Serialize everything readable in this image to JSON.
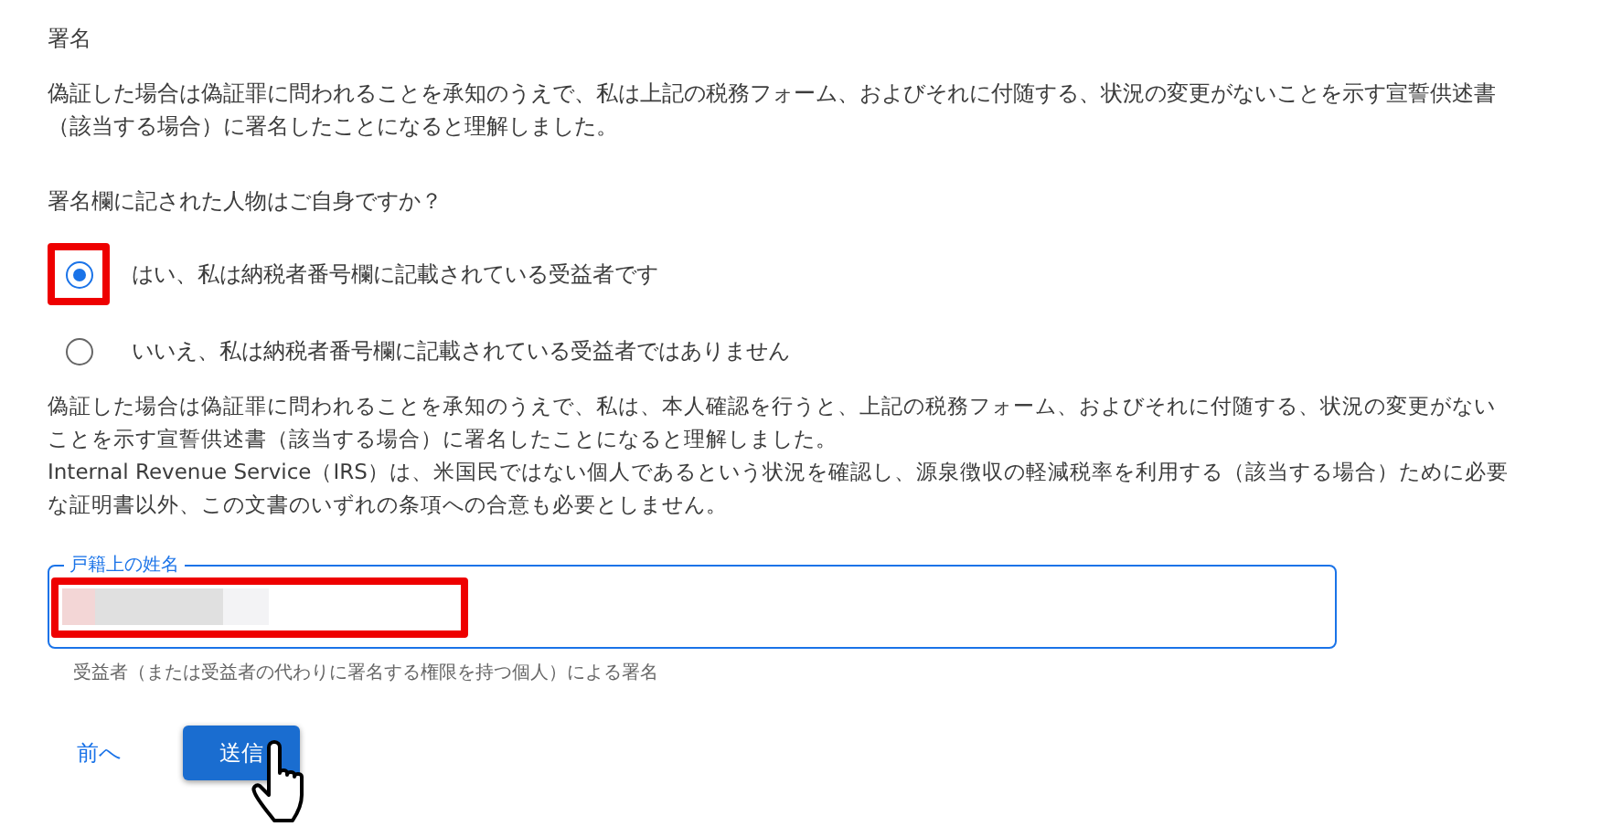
{
  "section_title": "署名",
  "statement": "偽証した場合は偽証罪に問われることを承知のうえで、私は上記の税務フォーム、およびそれに付随する、状況の変更がないことを示す宣誓供述書（該当する場合）に署名したことになると理解しました。",
  "question": "署名欄に記された人物はご自身ですか？",
  "options": [
    {
      "label": "はい、私は納税者番号欄に記載されている受益者です",
      "selected": true,
      "highlighted": true
    },
    {
      "label": "いいえ、私は納税者番号欄に記載されている受益者ではありません",
      "selected": false,
      "highlighted": false
    }
  ],
  "notice": [
    "偽証した場合は偽証罪に問われることを承知のうえで、私は、本人確認を行うと、上記の税務フォーム、およびそれに付随する、状況の変更がないことを示す宣誓供述書（該当する場合）に署名したことになると理解しました。",
    "Internal Revenue Service（IRS）は、米国民ではない個人であるという状況を確認し、源泉徴収の軽減税率を利用する（該当する場合）ために必要な証明書以外、この文書のいずれの条項への合意も必要としません。"
  ],
  "name_field": {
    "label": "戸籍上の姓名",
    "redacted": true,
    "highlighted": true,
    "helper": "受益者（または受益者の代わりに署名する権限を持つ個人）による署名"
  },
  "buttons": [
    {
      "label": "前へ",
      "kind": "text"
    },
    {
      "label": "送信",
      "kind": "primary"
    }
  ]
}
